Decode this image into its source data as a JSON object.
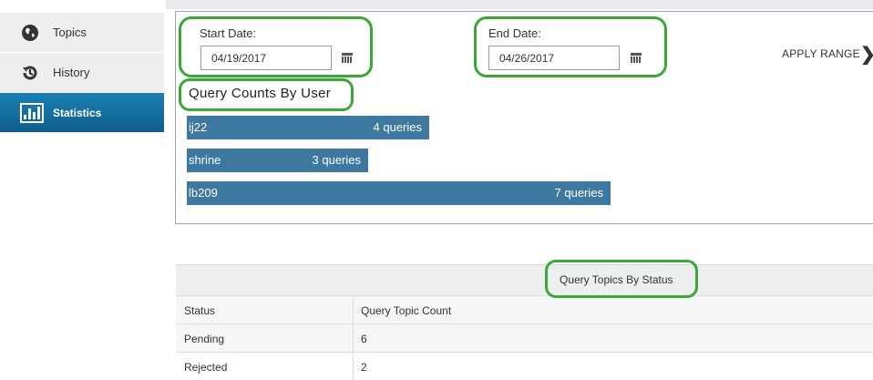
{
  "sidebar": {
    "items": [
      {
        "label": "Topics",
        "icon": "globe-icon"
      },
      {
        "label": "History",
        "icon": "history-icon"
      },
      {
        "label": "Statistics",
        "icon": "bar-chart-icon"
      }
    ]
  },
  "date_range": {
    "start_label": "Start Date:",
    "start_value": "04/19/2017",
    "end_label": "End Date:",
    "end_value": "04/26/2017",
    "apply_label": "APPLY RANGE"
  },
  "query_counts": {
    "title": "Query Counts By User"
  },
  "chart_data": {
    "type": "bar",
    "orientation": "horizontal",
    "title": "Query Counts By User",
    "categories": [
      "ij22",
      "shrine",
      "lb209"
    ],
    "values": [
      4,
      3,
      7
    ],
    "value_labels": [
      "4 queries",
      "3 queries",
      "7 queries"
    ],
    "color": "#3d78a1"
  },
  "topics_table": {
    "caption": "Query Topics By Status",
    "headers": [
      "Status",
      "Query Topic Count"
    ],
    "rows": [
      [
        "Pending",
        "6"
      ],
      [
        "Rejected",
        "2"
      ]
    ]
  },
  "colors": {
    "accent": "#1a7fb2",
    "bar": "#3d78a1",
    "annotation": "#3aa837"
  }
}
